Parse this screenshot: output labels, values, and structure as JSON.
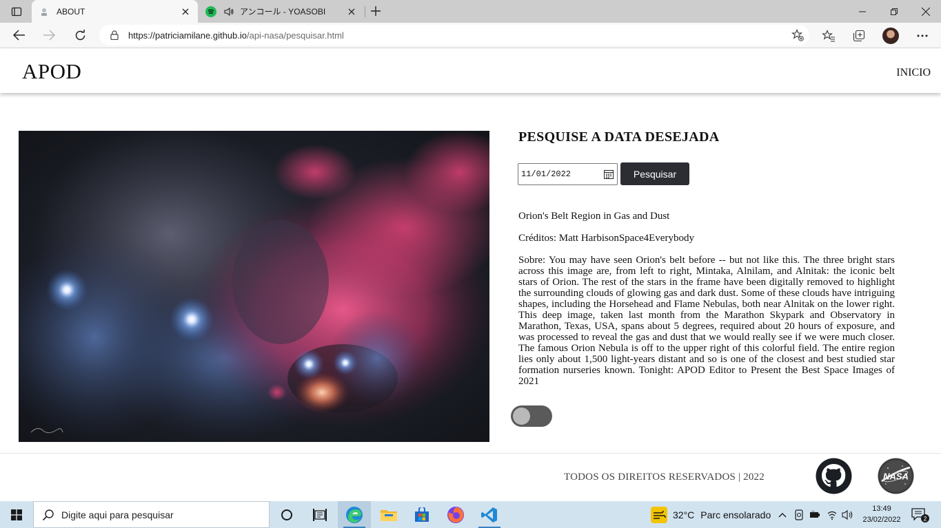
{
  "browser": {
    "tabs": [
      {
        "title": "ABOUT",
        "active": true
      },
      {
        "title": "アンコール - YOASOBI",
        "active": false
      }
    ],
    "url_host": "https://patriciamilane.github.io",
    "url_path": "/api-nasa/pesquisar.html"
  },
  "header": {
    "brand": "APOD",
    "nav_link": "INICIO"
  },
  "search": {
    "title": "PESQUISE A DATA DESEJADA",
    "date_value": "11/01/2022",
    "button_label": "Pesquisar"
  },
  "apod": {
    "title": "Orion's Belt Region in Gas and Dust",
    "credits": "Créditos: Matt HarbisonSpace4Everybody",
    "about": "Sobre: You may have seen Orion's belt before -- but not like this. The three bright stars across this image are, from left to right, Mintaka, Alnilam, and Alnitak: the iconic belt stars of Orion. The rest of the stars in the frame have been digitally removed to highlight the surrounding clouds of glowing gas and dark dust. Some of these clouds have intriguing shapes, including the Horsehead and Flame Nebulas, both near Alnitak on the lower right. This deep image, taken last month from the Marathon Skypark and Observatory in Marathon, Texas, USA, spans about 5 degrees, required about 20 hours of exposure, and was processed to reveal the gas and dust that we would really see if we were much closer. The famous Orion Nebula is off to the upper right of this colorful field. The entire region lies only about 1,500 light-years distant and so is one of the closest and best studied star formation nurseries known. Tonight: APOD Editor to Present the Best Space Images of 2021"
  },
  "theme_toggle": {
    "on": false
  },
  "footer": {
    "text": "TODOS OS DIREITOS RESERVADOS | 2022",
    "nasa_logo_text": "NASA"
  },
  "taskbar": {
    "search_placeholder": "Digite aqui para pesquisar",
    "weather_temp": "32°C",
    "weather_desc": "Parc ensolarado",
    "time": "13:49",
    "date": "23/02/2022",
    "notification_count": "2"
  },
  "colors": {
    "button_bg": "#2b2d33",
    "toggle_track": "#5a5a5a",
    "taskbar_bg": "#d2e3f0",
    "nebula_pink": "#e8447a",
    "star_blue": "#7fb2ff"
  }
}
